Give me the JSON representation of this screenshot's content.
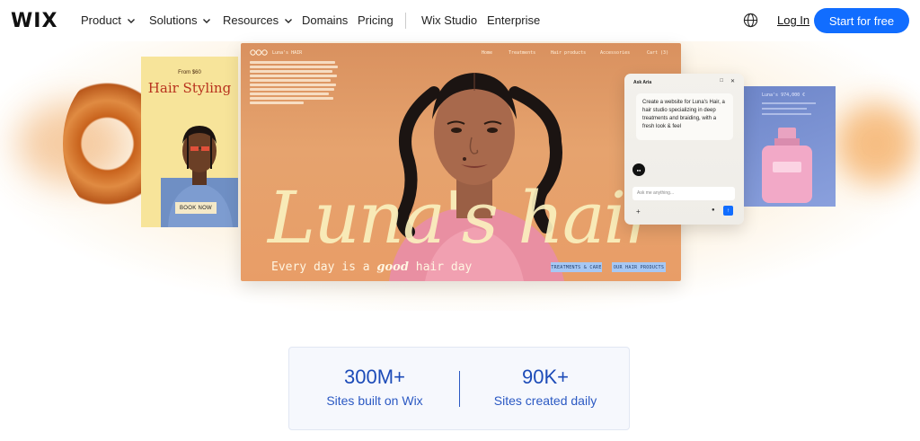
{
  "nav": {
    "logo": "WIX",
    "items": [
      {
        "label": "Product",
        "dropdown": true
      },
      {
        "label": "Solutions",
        "dropdown": true
      },
      {
        "label": "Resources",
        "dropdown": true
      },
      {
        "label": "Domains",
        "dropdown": false
      },
      {
        "label": "Pricing",
        "dropdown": false
      },
      {
        "label": "Wix Studio",
        "dropdown": false
      },
      {
        "label": "Enterprise",
        "dropdown": false
      }
    ],
    "login": "Log In",
    "cta": "Start for free",
    "cta_color": "#116dff"
  },
  "hero": {
    "styling_card": {
      "from": "From $60",
      "title": "Hair Styling",
      "button": "BOOK NOW"
    },
    "main_card": {
      "brand": "Luna's HAIR",
      "nav": [
        "Home",
        "Treatments",
        "Hair products",
        "Accessories",
        "Cart (3)"
      ],
      "script_title": "Luna's hair",
      "tagline_pre": "Every day is a",
      "tagline_em": "good",
      "tagline_post": "hair day",
      "buttons": [
        "TREATMENTS & CARE",
        "OUR HAIR PRODUCTS"
      ]
    },
    "perfume_card": {
      "label": "Luna's 974,000 €"
    },
    "chat": {
      "title": "Ask Aria",
      "message": "Create a website for Luna's Hair, a hair studio specializing in deep treatments and braiding, with a fresh look & feel",
      "input_placeholder": "Ask me anything...",
      "avatar_icon": "wix-avatar-icon"
    }
  },
  "stats": [
    {
      "value": "300M+",
      "label": "Sites built on Wix"
    },
    {
      "value": "90K+",
      "label": "Sites created daily"
    }
  ]
}
